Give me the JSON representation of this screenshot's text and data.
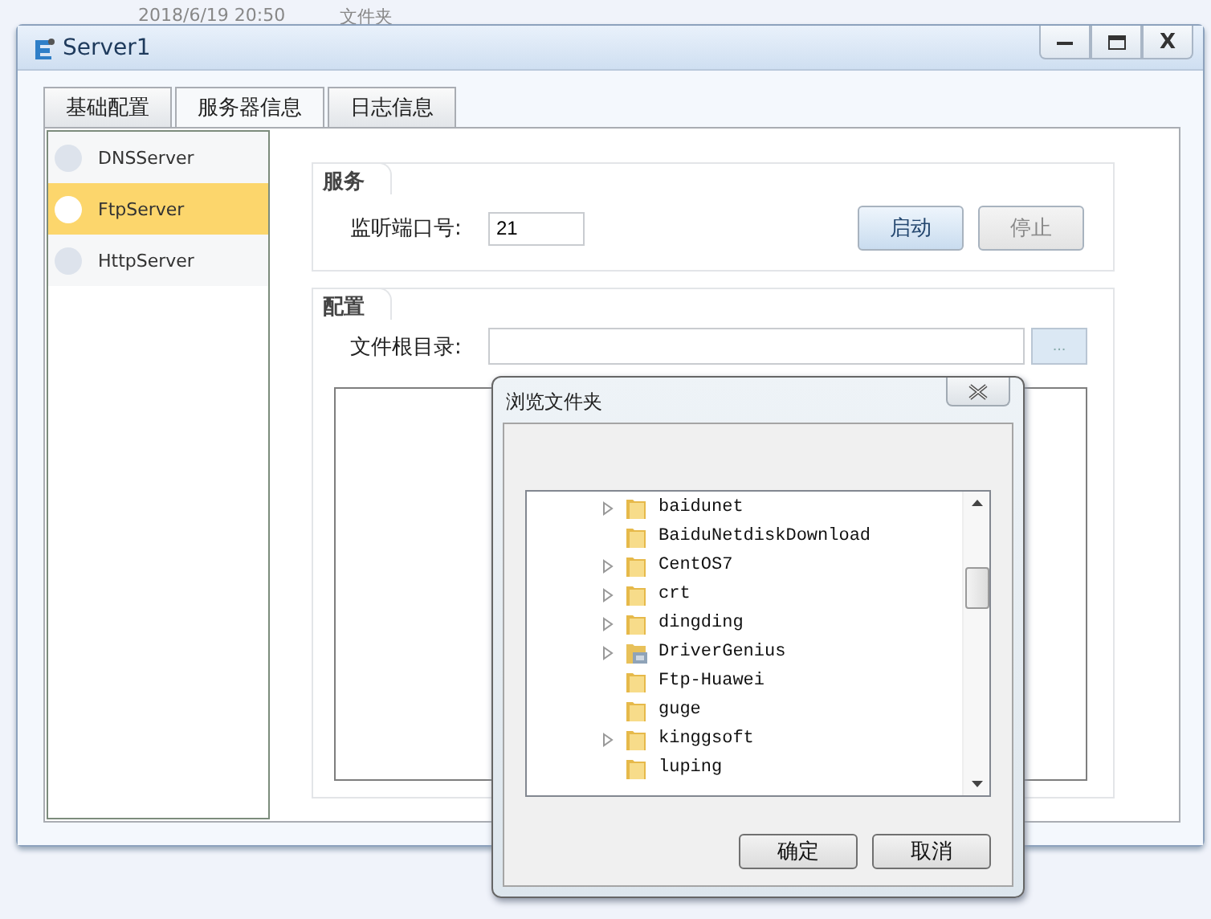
{
  "background": {
    "date": "2018/6/19 20:50",
    "type": "文件夹"
  },
  "window": {
    "title": "Server1",
    "close": "X"
  },
  "tabs": [
    {
      "label": "基础配置",
      "selected": false
    },
    {
      "label": "服务器信息",
      "selected": true
    },
    {
      "label": "日志信息",
      "selected": false
    }
  ],
  "sidebar": {
    "items": [
      {
        "label": "DNSServer",
        "selected": false
      },
      {
        "label": "FtpServer",
        "selected": true
      },
      {
        "label": "HttpServer",
        "selected": false
      }
    ]
  },
  "service_group": {
    "title": "服务",
    "port_label": "监听端口号:",
    "port_value": "21",
    "buttons": [
      {
        "label": "启动",
        "disabled": false
      },
      {
        "label": "停止",
        "disabled": true
      }
    ]
  },
  "config_group": {
    "title": "配置",
    "root_label": "文件根目录:",
    "browse_button": "..."
  },
  "dialog": {
    "title": "浏览文件夹",
    "folders": [
      {
        "name": "baidunet",
        "expandable": true,
        "kind": "folder"
      },
      {
        "name": "BaiduNetdiskDownload",
        "expandable": false,
        "kind": "folder"
      },
      {
        "name": "CentOS7",
        "expandable": true,
        "kind": "folder"
      },
      {
        "name": "crt",
        "expandable": true,
        "kind": "folder"
      },
      {
        "name": "dingding",
        "expandable": true,
        "kind": "folder"
      },
      {
        "name": "DriverGenius",
        "expandable": true,
        "kind": "program"
      },
      {
        "name": "Ftp-Huawei",
        "expandable": false,
        "kind": "folder"
      },
      {
        "name": "guge",
        "expandable": false,
        "kind": "folder"
      },
      {
        "name": "kinggsoft",
        "expandable": true,
        "kind": "folder"
      },
      {
        "name": "luping",
        "expandable": false,
        "kind": "folder"
      }
    ],
    "buttons": [
      "确定",
      "取消"
    ]
  }
}
